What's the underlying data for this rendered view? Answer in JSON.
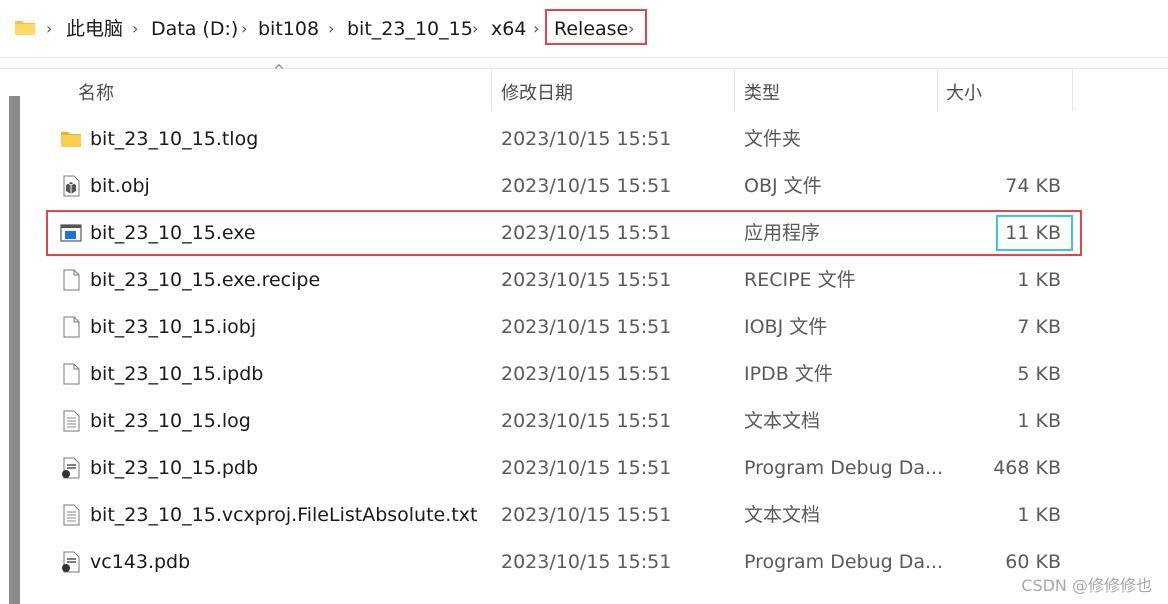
{
  "breadcrumb": {
    "items": [
      "此电脑",
      "Data (D:)",
      "bit108",
      "bit_23_10_15",
      "x64",
      "Release"
    ],
    "separator": "›"
  },
  "columns": {
    "name": "名称",
    "date": "修改日期",
    "type": "类型",
    "size": "大小"
  },
  "files": [
    {
      "name": "bit_23_10_15.tlog",
      "date": "2023/10/15 15:51",
      "type": "文件夹",
      "size": "",
      "icon": "folder-icon"
    },
    {
      "name": "bit.obj",
      "date": "2023/10/15 15:51",
      "type": "OBJ 文件",
      "size": "74 KB",
      "icon": "obj-file-icon"
    },
    {
      "name": "bit_23_10_15.exe",
      "date": "2023/10/15 15:51",
      "type": "应用程序",
      "size": "11 KB",
      "icon": "exe-icon"
    },
    {
      "name": "bit_23_10_15.exe.recipe",
      "date": "2023/10/15 15:51",
      "type": "RECIPE 文件",
      "size": "1 KB",
      "icon": "blank-file-icon"
    },
    {
      "name": "bit_23_10_15.iobj",
      "date": "2023/10/15 15:51",
      "type": "IOBJ 文件",
      "size": "7 KB",
      "icon": "blank-file-icon"
    },
    {
      "name": "bit_23_10_15.ipdb",
      "date": "2023/10/15 15:51",
      "type": "IPDB 文件",
      "size": "5 KB",
      "icon": "blank-file-icon"
    },
    {
      "name": "bit_23_10_15.log",
      "date": "2023/10/15 15:51",
      "type": "文本文档",
      "size": "1 KB",
      "icon": "text-file-icon"
    },
    {
      "name": "bit_23_10_15.pdb",
      "date": "2023/10/15 15:51",
      "type": "Program Debug Da...",
      "size": "468 KB",
      "icon": "pdb-file-icon"
    },
    {
      "name": "bit_23_10_15.vcxproj.FileListAbsolute.txt",
      "date": "2023/10/15 15:51",
      "type": "文本文档",
      "size": "1 KB",
      "icon": "text-file-icon"
    },
    {
      "name": "vc143.pdb",
      "date": "2023/10/15 15:51",
      "type": "Program Debug Da...",
      "size": "60 KB",
      "icon": "pdb-file-icon"
    }
  ],
  "watermark": "CSDN @修修修也",
  "colors": {
    "highlight_red": "#e0474c",
    "highlight_cyan": "#3cc8cc",
    "folder_yellow": "#f4c243"
  }
}
